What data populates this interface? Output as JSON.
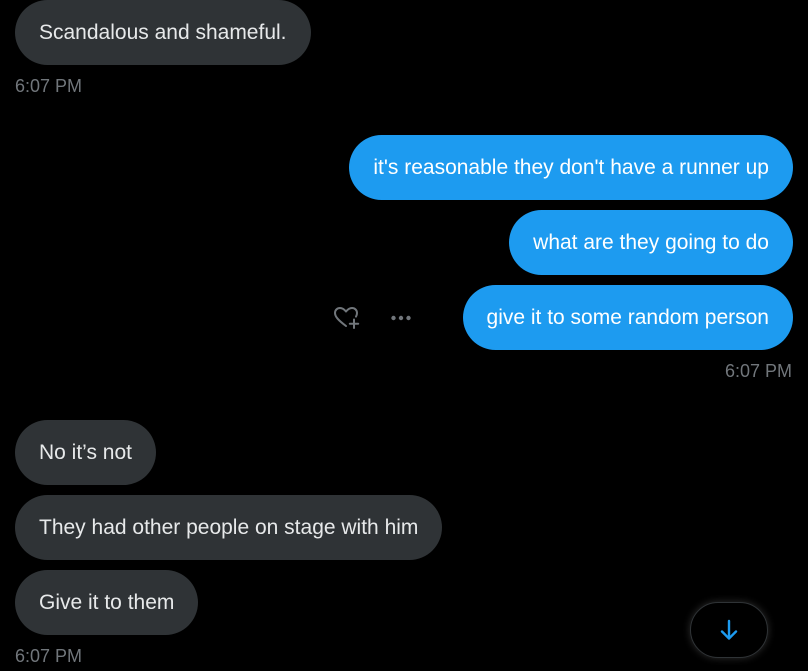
{
  "messages": {
    "m1": "Scandalous and shameful.",
    "m2": "it's reasonable they don't have a runner up",
    "m3": "what are they going to do",
    "m4": "give it to some random person",
    "m5": "No it’s not",
    "m6": "They had other people on stage with him",
    "m7": "Give it to them"
  },
  "timestamps": {
    "t1": "6:07 PM",
    "t2": "6:07 PM",
    "t3": "6:07 PM"
  },
  "icons": {
    "react": "heart-plus-icon",
    "more": "more-dots-icon",
    "scroll": "arrow-down-icon"
  },
  "colors": {
    "background": "#000000",
    "incoming_bubble": "#2f3336",
    "outgoing_bubble": "#1d9bf0",
    "timestamp": "#71767b",
    "accent": "#1d9bf0"
  }
}
